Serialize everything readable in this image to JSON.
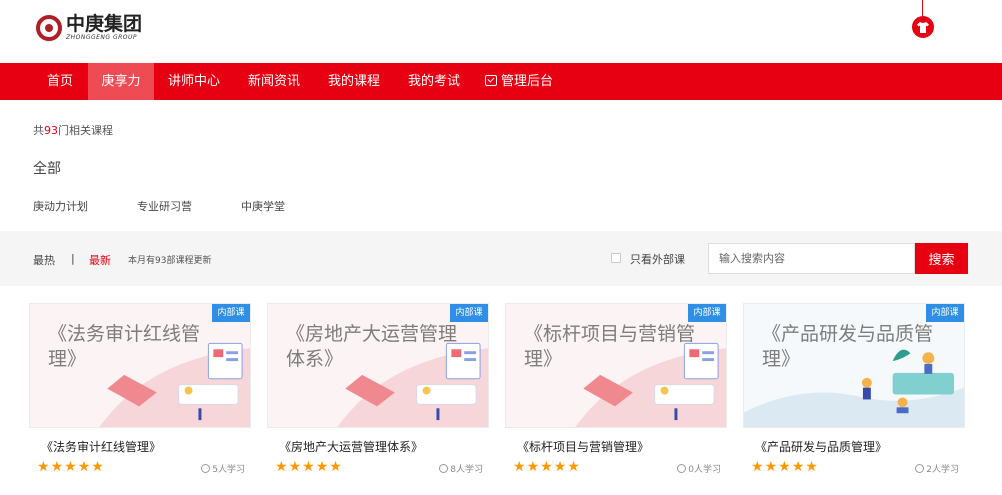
{
  "header": {
    "logo_cn": "中庚集团",
    "logo_en": "ZHONGGENG GROUP",
    "user_icon": "tshirt-icon"
  },
  "nav": [
    {
      "label": "首页"
    },
    {
      "label": "庚享力"
    },
    {
      "label": "讲师中心"
    },
    {
      "label": "新闻资讯"
    },
    {
      "label": "我的课程"
    },
    {
      "label": "我的考试"
    },
    {
      "label": "管理后台",
      "icon": "dashboard-icon"
    }
  ],
  "filter": {
    "count_prefix": "共",
    "count_num": "93",
    "count_suffix": "门相关课程",
    "all_label": "全部",
    "subcats": [
      "庚动力计划",
      "专业研习营",
      "中庚学堂"
    ]
  },
  "sort": {
    "hot": "最热",
    "sep": "|",
    "newest": "最新",
    "note": "本月有93部课程更新",
    "external_label": "只看外部课",
    "search_placeholder": "输入搜索内容",
    "search_button": "搜索"
  },
  "colors": {
    "brand": "#e60012",
    "badge": "#2f8ee6",
    "star": "#ff9800"
  },
  "courses": [
    {
      "thumb_title": "《法务审计红线管理》",
      "badge": "内部课",
      "name": "《法务审计红线管理》",
      "rating": 5,
      "learners": "5人学习",
      "theme": "pink"
    },
    {
      "thumb_title": "《房地产大运营管理体系》",
      "badge": "内部课",
      "name": "《房地产大运营管理体系》",
      "rating": 5,
      "learners": "8人学习",
      "theme": "pink"
    },
    {
      "thumb_title": "《标杆项目与营销管理》",
      "badge": "内部课",
      "name": "《标杆项目与营销管理》",
      "rating": 5,
      "learners": "0人学习",
      "theme": "pink"
    },
    {
      "thumb_title": "《产品研发与品质管理》",
      "badge": "内部课",
      "name": "《产品研发与品质管理》",
      "rating": 5,
      "learners": "2人学习",
      "theme": "blue"
    }
  ]
}
